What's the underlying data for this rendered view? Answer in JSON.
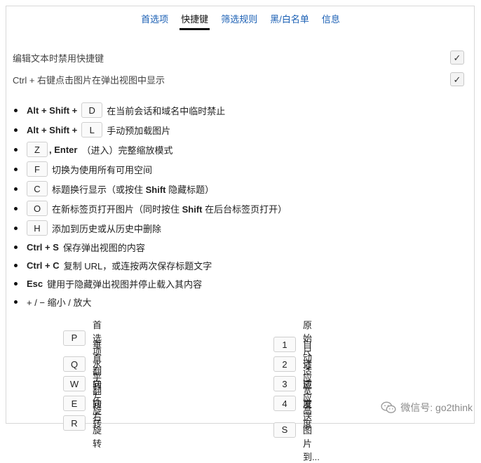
{
  "tabs": [
    "首选项",
    "快捷键",
    "筛选规则",
    "黑/白名单",
    "信息"
  ],
  "active_tab": 1,
  "options": [
    {
      "label": "编辑文本时禁用快捷键",
      "checked": true
    },
    {
      "label": "Ctrl + 右键点击图片在弹出视图中显示",
      "checked": true
    }
  ],
  "shortcuts": {
    "s1": {
      "combo": "Alt + Shift +",
      "key": "D",
      "desc": "在当前会话和域名中临时禁止"
    },
    "s2": {
      "combo": "Alt + Shift +",
      "key": "L",
      "desc": "手动预加载图片"
    },
    "s3": {
      "key": "Z",
      "combo2": ", Enter",
      "desc": "（进入）完整缩放模式"
    },
    "s4": {
      "key": "F",
      "desc": "切换为使用所有可用空间"
    },
    "s5": {
      "key": "C",
      "desc_pre": "标题换行显示（或按住 ",
      "bold": "Shift",
      "desc_post": " 隐藏标题）"
    },
    "s6": {
      "key": "O",
      "desc_pre": "在新标签页打开图片（同时按住 ",
      "bold": "Shift",
      "desc_post": " 在后台标签页打开）"
    },
    "s7": {
      "key": "H",
      "desc": "添加到历史或从历史中删除"
    },
    "s8": {
      "combo": "Ctrl + S",
      "desc": "保存弹出视图的内容"
    },
    "s9": {
      "combo": "Ctrl + C",
      "desc": "复制 URL，或连按两次保存标题文字"
    },
    "s10": {
      "combo": "Esc",
      "desc": "键用于隐藏弹出视图并停止载入其内容"
    },
    "s11": {
      "desc": "+ / − 缩小 / 放大"
    }
  },
  "zoom_keys_left": [
    {
      "key": "P",
      "label": "首选项"
    },
    {
      "key": "Q",
      "label": "垂直翻转"
    },
    {
      "key": "W",
      "label": "水平翻转"
    },
    {
      "key": "E",
      "label": "向左旋转"
    },
    {
      "key": "R",
      "label": "向右旋转"
    }
  ],
  "zoom_keys_right": [
    {
      "key": "1",
      "label": "原始尺寸"
    },
    {
      "key": "2",
      "label": "自动适应"
    },
    {
      "key": "3",
      "label": "适应宽度"
    },
    {
      "key": "4",
      "label": "适应高度"
    },
    {
      "key": "S",
      "label": "发送图片到..."
    }
  ],
  "watermark": "微信号: go2think",
  "icons": {
    "check": "check-icon",
    "wechat": "wechat-icon"
  },
  "colors": {
    "tab_link": "#1a5fb4",
    "active_underline": "#111111"
  }
}
